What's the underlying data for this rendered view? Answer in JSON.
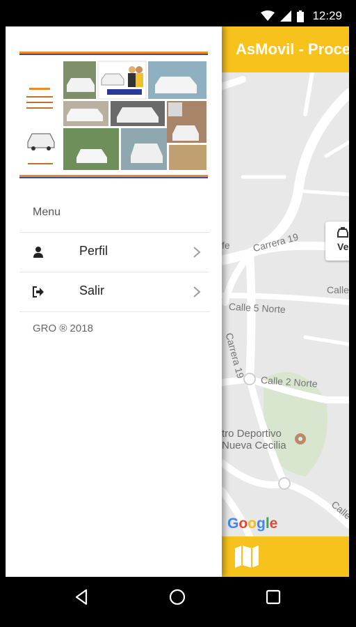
{
  "status_bar": {
    "time": "12:29",
    "icons": [
      "wifi-icon",
      "signal-icon",
      "battery-icon"
    ]
  },
  "app": {
    "title": "AsMovil - Proce",
    "accent_color": "#f7c21b"
  },
  "map": {
    "labels": {
      "carrera19_top": "Carrera 19",
      "calle5": "Calle 5 Norte",
      "carrera19_side": "Carrera 19",
      "calle2": "Calle 2 Norte",
      "park_line1": "tro Deportivo",
      "park_line2": "Nueva Cecilia",
      "calle_right": "Calle",
      "calle_bottom": "Calle",
      "fe": "fe"
    },
    "chip_text": "Ve",
    "google": [
      "G",
      "o",
      "o",
      "g",
      "l",
      "e"
    ]
  },
  "drawer": {
    "menu_title": "Menu",
    "items": [
      {
        "label": "Perfil",
        "icon": "user-icon"
      },
      {
        "label": "Salir",
        "icon": "logout-icon"
      }
    ],
    "footer": "GRO ® 2018"
  },
  "nav_bar": {
    "buttons": [
      "back-icon",
      "home-icon",
      "recents-icon"
    ]
  }
}
